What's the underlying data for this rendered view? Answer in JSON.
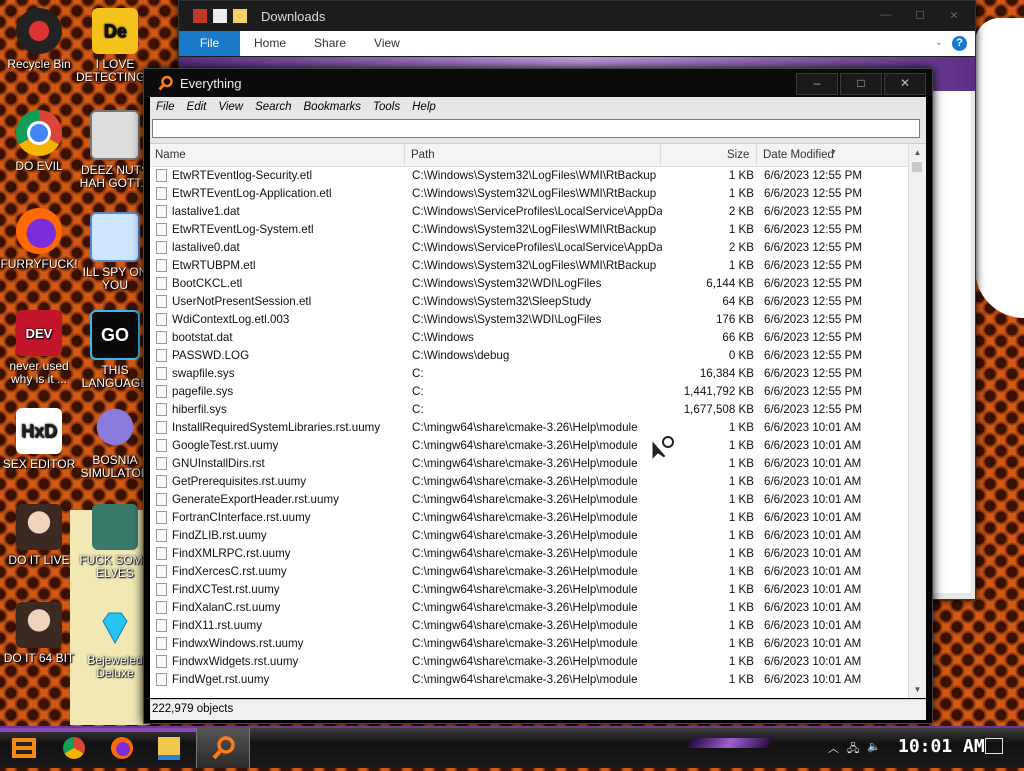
{
  "desktop": {
    "icons": [
      {
        "label": "Recycle Bin"
      },
      {
        "label": "I LOVE DETECTING..."
      },
      {
        "label": "DO EVIL"
      },
      {
        "label": "DEEZ NUTS HAH GOTT..."
      },
      {
        "label": "FURRYFUCK!"
      },
      {
        "label": "ILL SPY ON YOU"
      },
      {
        "label": "never used why is it ..."
      },
      {
        "label": "THIS LANGUAGE ..."
      },
      {
        "label": "SEX EDITOR"
      },
      {
        "label": "BOSNIA SIMULATOR"
      },
      {
        "label": "DO IT LIVE"
      },
      {
        "label": "FUCK SOME ELVES"
      },
      {
        "label": "DO IT 64 BIT"
      },
      {
        "label": "Bejeweled Deluxe"
      }
    ]
  },
  "explorer": {
    "title": "Downloads",
    "tabs": [
      "File",
      "Home",
      "Share",
      "View"
    ]
  },
  "everything": {
    "title": "Everything",
    "menu": [
      "File",
      "Edit",
      "View",
      "Search",
      "Bookmarks",
      "Tools",
      "Help"
    ],
    "search_value": "",
    "columns": {
      "name": "Name",
      "path": "Path",
      "size": "Size",
      "date": "Date Modified"
    },
    "rows": [
      {
        "name": "EtwRTEventlog-Security.etl",
        "path": "C:\\Windows\\System32\\LogFiles\\WMI\\RtBackup",
        "size": "1 KB",
        "date": "6/6/2023 12:55 PM"
      },
      {
        "name": "EtwRTEventLog-Application.etl",
        "path": "C:\\Windows\\System32\\LogFiles\\WMI\\RtBackup",
        "size": "1 KB",
        "date": "6/6/2023 12:55 PM"
      },
      {
        "name": "lastalive1.dat",
        "path": "C:\\Windows\\ServiceProfiles\\LocalService\\AppDat...",
        "size": "2 KB",
        "date": "6/6/2023 12:55 PM"
      },
      {
        "name": "EtwRTEventLog-System.etl",
        "path": "C:\\Windows\\System32\\LogFiles\\WMI\\RtBackup",
        "size": "1 KB",
        "date": "6/6/2023 12:55 PM"
      },
      {
        "name": "lastalive0.dat",
        "path": "C:\\Windows\\ServiceProfiles\\LocalService\\AppDat...",
        "size": "2 KB",
        "date": "6/6/2023 12:55 PM"
      },
      {
        "name": "EtwRTUBPM.etl",
        "path": "C:\\Windows\\System32\\LogFiles\\WMI\\RtBackup",
        "size": "1 KB",
        "date": "6/6/2023 12:55 PM"
      },
      {
        "name": "BootCKCL.etl",
        "path": "C:\\Windows\\System32\\WDI\\LogFiles",
        "size": "6,144 KB",
        "date": "6/6/2023 12:55 PM"
      },
      {
        "name": "UserNotPresentSession.etl",
        "path": "C:\\Windows\\System32\\SleepStudy",
        "size": "64 KB",
        "date": "6/6/2023 12:55 PM"
      },
      {
        "name": "WdiContextLog.etl.003",
        "path": "C:\\Windows\\System32\\WDI\\LogFiles",
        "size": "176 KB",
        "date": "6/6/2023 12:55 PM"
      },
      {
        "name": "bootstat.dat",
        "path": "C:\\Windows",
        "size": "66 KB",
        "date": "6/6/2023 12:55 PM"
      },
      {
        "name": "PASSWD.LOG",
        "path": "C:\\Windows\\debug",
        "size": "0 KB",
        "date": "6/6/2023 12:55 PM"
      },
      {
        "name": "swapfile.sys",
        "path": "C:",
        "size": "16,384 KB",
        "date": "6/6/2023 12:55 PM"
      },
      {
        "name": "pagefile.sys",
        "path": "C:",
        "size": "1,441,792 KB",
        "date": "6/6/2023 12:55 PM"
      },
      {
        "name": "hiberfil.sys",
        "path": "C:",
        "size": "1,677,508 KB",
        "date": "6/6/2023 12:55 PM"
      },
      {
        "name": "InstallRequiredSystemLibraries.rst.uumy",
        "path": "C:\\mingw64\\share\\cmake-3.26\\Help\\module",
        "size": "1 KB",
        "date": "6/6/2023 10:01 AM"
      },
      {
        "name": "GoogleTest.rst.uumy",
        "path": "C:\\mingw64\\share\\cmake-3.26\\Help\\module",
        "size": "1 KB",
        "date": "6/6/2023 10:01 AM"
      },
      {
        "name": "GNUInstallDirs.rst",
        "path": "C:\\mingw64\\share\\cmake-3.26\\Help\\module",
        "size": "1 KB",
        "date": "6/6/2023 10:01 AM"
      },
      {
        "name": "GetPrerequisites.rst.uumy",
        "path": "C:\\mingw64\\share\\cmake-3.26\\Help\\module",
        "size": "1 KB",
        "date": "6/6/2023 10:01 AM"
      },
      {
        "name": "GenerateExportHeader.rst.uumy",
        "path": "C:\\mingw64\\share\\cmake-3.26\\Help\\module",
        "size": "1 KB",
        "date": "6/6/2023 10:01 AM"
      },
      {
        "name": "FortranCInterface.rst.uumy",
        "path": "C:\\mingw64\\share\\cmake-3.26\\Help\\module",
        "size": "1 KB",
        "date": "6/6/2023 10:01 AM"
      },
      {
        "name": "FindZLIB.rst.uumy",
        "path": "C:\\mingw64\\share\\cmake-3.26\\Help\\module",
        "size": "1 KB",
        "date": "6/6/2023 10:01 AM"
      },
      {
        "name": "FindXMLRPC.rst.uumy",
        "path": "C:\\mingw64\\share\\cmake-3.26\\Help\\module",
        "size": "1 KB",
        "date": "6/6/2023 10:01 AM"
      },
      {
        "name": "FindXercesC.rst.uumy",
        "path": "C:\\mingw64\\share\\cmake-3.26\\Help\\module",
        "size": "1 KB",
        "date": "6/6/2023 10:01 AM"
      },
      {
        "name": "FindXCTest.rst.uumy",
        "path": "C:\\mingw64\\share\\cmake-3.26\\Help\\module",
        "size": "1 KB",
        "date": "6/6/2023 10:01 AM"
      },
      {
        "name": "FindXalanC.rst.uumy",
        "path": "C:\\mingw64\\share\\cmake-3.26\\Help\\module",
        "size": "1 KB",
        "date": "6/6/2023 10:01 AM"
      },
      {
        "name": "FindX11.rst.uumy",
        "path": "C:\\mingw64\\share\\cmake-3.26\\Help\\module",
        "size": "1 KB",
        "date": "6/6/2023 10:01 AM"
      },
      {
        "name": "FindwxWindows.rst.uumy",
        "path": "C:\\mingw64\\share\\cmake-3.26\\Help\\module",
        "size": "1 KB",
        "date": "6/6/2023 10:01 AM"
      },
      {
        "name": "FindwxWidgets.rst.uumy",
        "path": "C:\\mingw64\\share\\cmake-3.26\\Help\\module",
        "size": "1 KB",
        "date": "6/6/2023 10:01 AM"
      },
      {
        "name": "FindWget.rst.uumy",
        "path": "C:\\mingw64\\share\\cmake-3.26\\Help\\module",
        "size": "1 KB",
        "date": "6/6/2023 10:01 AM"
      }
    ],
    "status": "222,979 objects"
  },
  "taskbar": {
    "clock": "10:01 AM"
  },
  "colors": {
    "accent": "#1979ca",
    "desktop_bg": "#d35a16",
    "taskbar_purple": "#8a49b6"
  }
}
